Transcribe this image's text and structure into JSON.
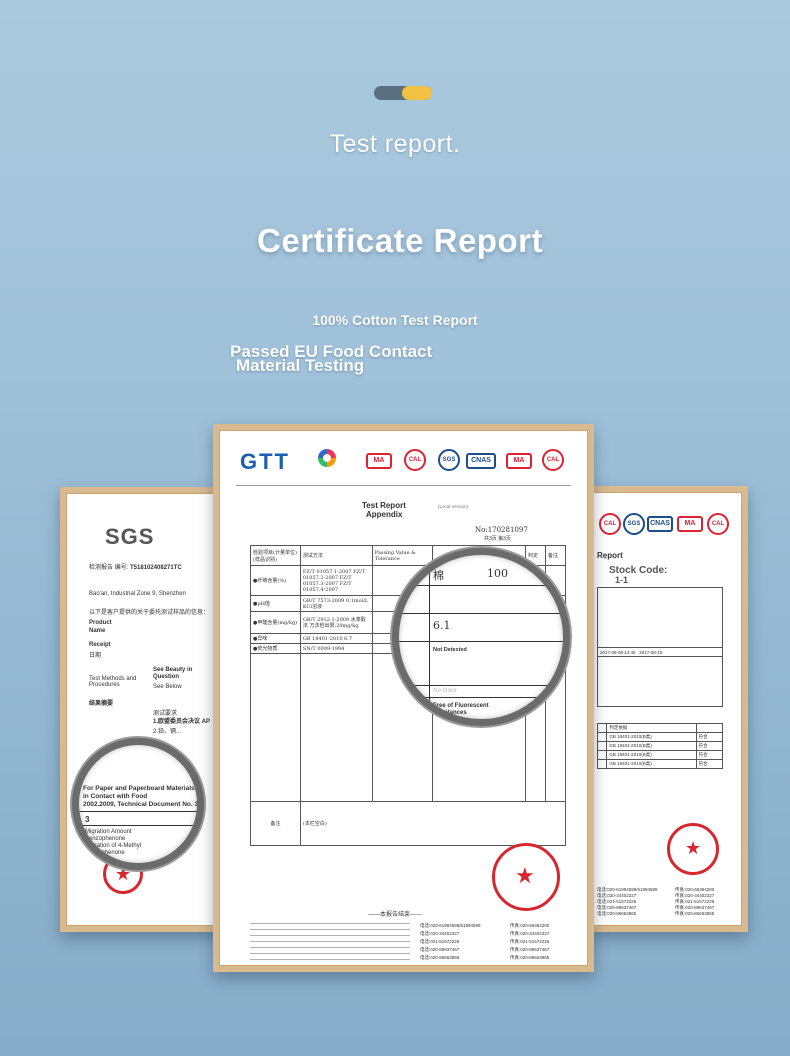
{
  "header": {
    "title_small": "Test report.",
    "title_big": "Certificate Report",
    "subtitle_1": "100% Cotton Test Report",
    "subtitle_2a": "Passed EU Food Contact",
    "subtitle_2b": "Material Testing"
  },
  "colors": {
    "background": "#9fc1d9",
    "accent_yellow": "#f3c143",
    "frame_wood": "#d9b98e",
    "stamp_red": "#d6262e",
    "gtt_blue": "#1b5fae"
  },
  "left_doc": {
    "logo": "SGS",
    "report_no": "T518102408271TC",
    "lines": [
      "Bao'an, Industrial Zone 9, Shenzhen",
      "以下是客户提供的关于委托测试样品的信息：",
      "Product",
      "Name",
      "Receipt",
      "日期",
      "Test Methods and Procedures",
      "Quantity",
      "See Below",
      "结果摘要",
      "测试要求",
      "1.欧盟委员会决议 AP",
      "2.铅、镉...",
      "For Paper and Paperboard Materials",
      "in Contact with Food",
      "2002.2009, Technical Document No. 3",
      "3",
      "Migration Amount",
      "Benzophenone",
      "Migration of 4-Methyl",
      "benzophenone",
      "See Beauty in Question"
    ]
  },
  "center_doc": {
    "logo": "GTT",
    "badges": [
      "MA",
      "CAL",
      "SGS",
      "CNAS",
      "MA",
      "CAL"
    ],
    "heading_1": "Test Report",
    "heading_2": "Appendix",
    "heading_note": "(Local Version)",
    "report_no": "No:170281097",
    "page": "共3页 第3页",
    "col_headers": [
      "检验项目(计量单位)(样品识别)",
      "测试方法",
      "Passing Value & Tolerance",
      "",
      "判定",
      "备注"
    ],
    "rows": [
      [
        "●纤维含量(%)",
        "FZ/T 01057.1-2007 FZ/T 01057.2-2007 FZ/T 01057.3-2007 FZ/T 01057.4-2007"
      ],
      [
        "●pH值",
        "GB/T 7573-2009 0.1mol/L KCl溶液"
      ],
      [
        "●甲醛含量(mg/kg)",
        "GB/T 2912.1-2009 水萃取法 方法检出限:20mg/kg"
      ],
      [
        "●异味",
        "GB 18401-2010 6.7"
      ],
      [
        "●荧光物质",
        "SN/T 0009-1994"
      ]
    ],
    "zoom": {
      "item_1": "棉",
      "value_1": "100",
      "value_2": "6.1",
      "note_1": "Not Detected",
      "note_2": "No Odor",
      "note_3": "Free of Fluorescent Substances"
    },
    "remark_label": "备注",
    "remark_text": "(本栏空白)",
    "end_text": "——本报告结束——",
    "footer_lines": [
      "电话:020-61994598/61994599",
      "电话:020-34402327",
      "电话:021-51572226",
      "电话:020-89637467",
      "电话:020-86663865",
      "传真:020-66364200",
      "传真:020-34402327",
      "传真:021-51572226",
      "传真:020-89637467",
      "传真:020-86663865"
    ]
  },
  "right_doc": {
    "badges": [
      "CAL",
      "SGS",
      "CNAS",
      "MA",
      "CAL"
    ],
    "heading": "Report",
    "stock_code": "Stock Code:",
    "stock_value": "1-1",
    "dates": [
      "2017-08-08 14:45",
      "2017-08-15"
    ],
    "result_label": "判定依据",
    "result_codes": [
      "GB 18401-2010(B类)",
      "GB 18401-2010(B类)",
      "GB 18401-2010(B类)",
      "GB 18401-2010(B类)"
    ],
    "results": [
      "符合",
      "符合",
      "符合",
      "符合"
    ],
    "phones": [
      "电话:020-61994598/61994599",
      "电话:020-34402327",
      "电话:021-51572226",
      "电话:020-89637467",
      "电话:020-86663865"
    ],
    "faxes": [
      "传真:020-66364200",
      "传真:020-34402327",
      "传真:021-51572226",
      "传真:020-89637467",
      "传真:020-86663865"
    ]
  }
}
